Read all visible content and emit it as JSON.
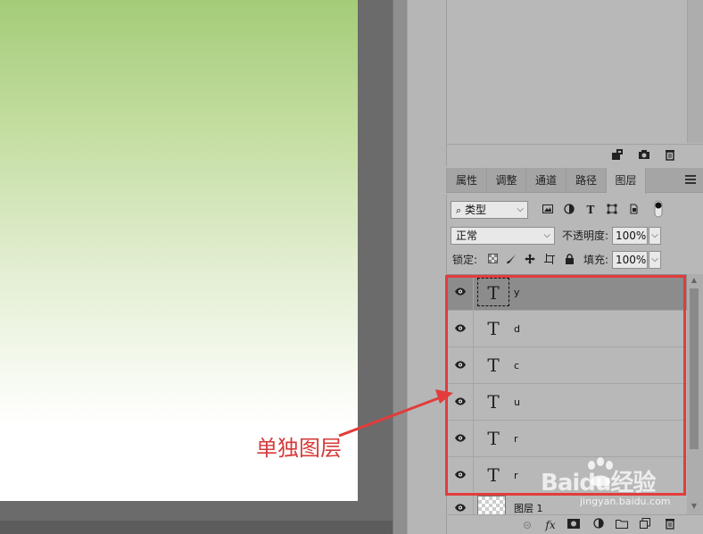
{
  "top_panel": {
    "buttons": [
      {
        "icon": "new-snapshot-icon"
      },
      {
        "icon": "camera-icon"
      },
      {
        "icon": "trash-icon"
      }
    ]
  },
  "tabs": [
    {
      "label": "属性",
      "active": false
    },
    {
      "label": "调整",
      "active": false
    },
    {
      "label": "通道",
      "active": false
    },
    {
      "label": "路径",
      "active": false
    },
    {
      "label": "图层",
      "active": true
    }
  ],
  "filter": {
    "kind_label": "类型",
    "icons": [
      "image-filter-icon",
      "adjustment-filter-icon",
      "type-filter-icon",
      "shape-filter-icon",
      "smart-object-filter-icon",
      "filter-toggle-icon"
    ]
  },
  "blend": {
    "mode": "正常",
    "opacity_label": "不透明度:",
    "opacity_value": "100%"
  },
  "lock": {
    "label": "锁定:",
    "fill_label": "填充:",
    "fill_value": "100%",
    "icons": [
      "lock-transparent-icon",
      "lock-pixels-icon",
      "lock-position-icon",
      "lock-artboard-icon",
      "lock-all-icon"
    ]
  },
  "layers": [
    {
      "name": "y",
      "type_glyph": "T",
      "selected": true
    },
    {
      "name": "d",
      "type_glyph": "T",
      "selected": false
    },
    {
      "name": "c",
      "type_glyph": "T",
      "selected": false
    },
    {
      "name": "u",
      "type_glyph": "T",
      "selected": false
    },
    {
      "name": "r",
      "type_glyph": "T",
      "selected": false
    },
    {
      "name": "r",
      "type_glyph": "T",
      "selected": false
    },
    {
      "name": "图层 1",
      "type_glyph": "",
      "selected": false
    }
  ],
  "bottom_bar": {
    "fx_label": "fx",
    "icons": [
      "link-icon",
      "fx-icon",
      "mask-icon",
      "adjustment-icon",
      "folder-icon",
      "new-layer-icon",
      "trash-icon"
    ]
  },
  "annotation": {
    "label": "单独图层",
    "color": "#e23c3c"
  },
  "watermark": {
    "brand": "Baidu经验",
    "url": "jingyan.baidu.com"
  }
}
